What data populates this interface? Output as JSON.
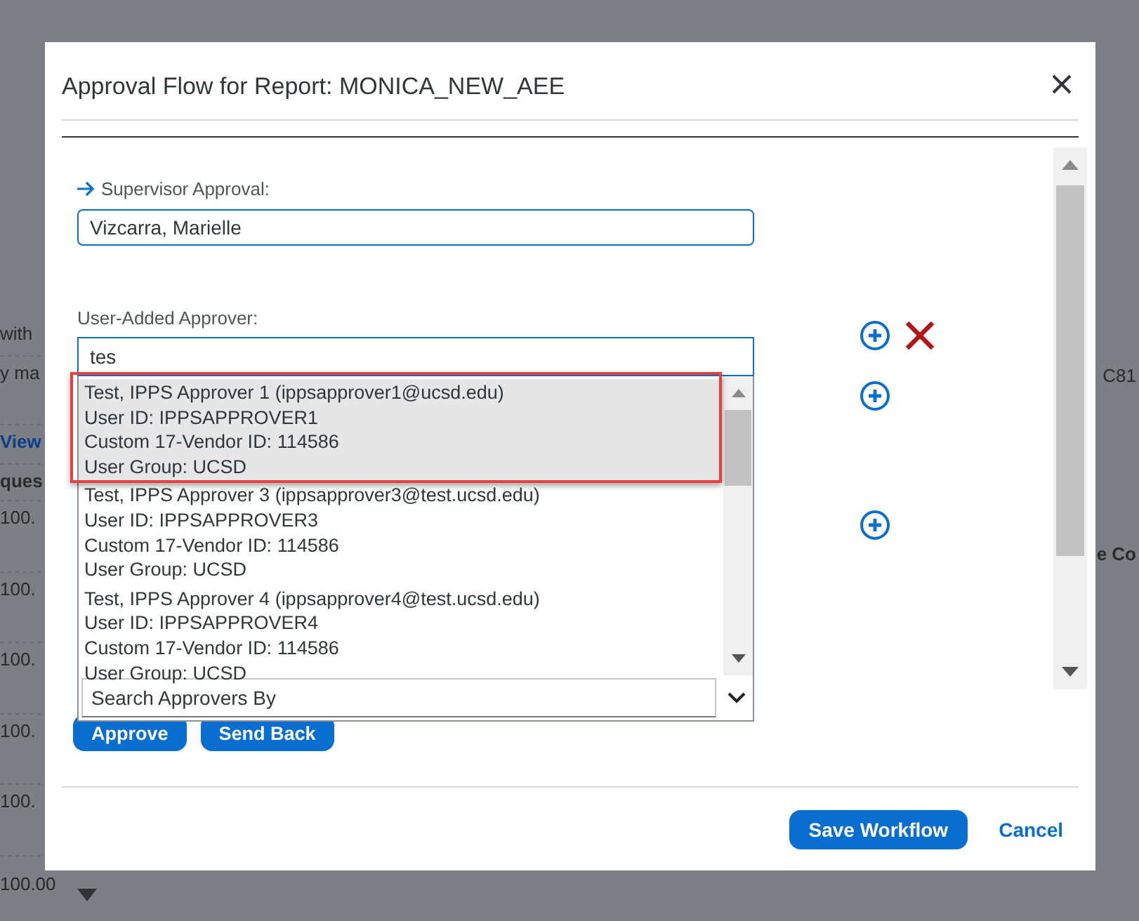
{
  "background": {
    "left_fragments": [
      {
        "text": "with",
        "kind": "plain"
      },
      {
        "text": "y ma",
        "kind": "plain"
      },
      {
        "text": "View",
        "kind": "link"
      },
      {
        "text": "ques",
        "kind": "heading"
      },
      {
        "text": "100.",
        "kind": "plain"
      },
      {
        "text": "100.",
        "kind": "plain"
      },
      {
        "text": "100.",
        "kind": "plain"
      },
      {
        "text": "100.",
        "kind": "plain"
      },
      {
        "text": "100.",
        "kind": "plain"
      },
      {
        "text": "100.00",
        "kind": "plain"
      }
    ],
    "right_fragments": [
      {
        "text": "C81",
        "kind": "plain"
      },
      {
        "text": "e Co",
        "kind": "heading"
      }
    ]
  },
  "dialog": {
    "title": "Approval Flow for Report: MONICA_NEW_AEE",
    "supervisor": {
      "label": "Supervisor Approval:",
      "value": "Vizcarra, Marielle"
    },
    "user_added": {
      "label": "User-Added Approver:",
      "value": "tes"
    },
    "approver_rows": [
      {
        "removable": true
      },
      {
        "removable": false
      },
      {
        "removable": false
      }
    ],
    "suggestions": [
      {
        "lines": [
          "Test, IPPS Approver 1 (ippsapprover1@ucsd.edu)",
          "User ID: IPPSAPPROVER1",
          "Custom 17-Vendor ID: 114586",
          "User Group: UCSD"
        ],
        "selected": true,
        "highlighted": true
      },
      {
        "lines": [
          "Test, IPPS Approver 3 (ippsapprover3@test.ucsd.edu)",
          "User ID: IPPSAPPROVER3",
          "Custom 17-Vendor ID: 114586",
          "User Group: UCSD"
        ],
        "selected": false,
        "highlighted": false
      },
      {
        "lines": [
          "Test, IPPS Approver 4 (ippsapprover4@test.ucsd.edu)",
          "User ID: IPPSAPPROVER4",
          "Custom 17-Vendor ID: 114586",
          "User Group: UCSD"
        ],
        "selected": false,
        "highlighted": false
      }
    ],
    "search_by": {
      "value": "Search Approvers By"
    },
    "actions": [
      "Approve",
      "Send Back"
    ],
    "footer": {
      "save": "Save Workflow",
      "cancel": "Cancel"
    }
  }
}
